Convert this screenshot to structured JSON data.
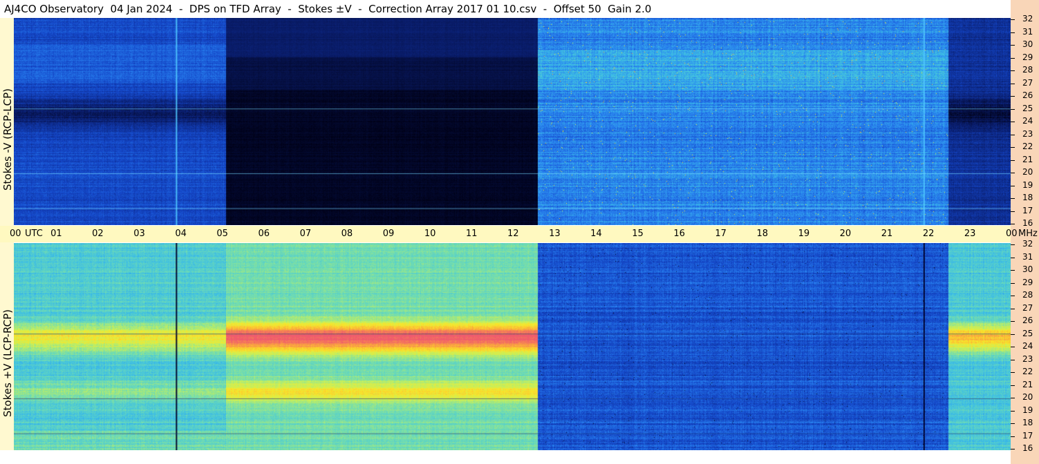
{
  "title": "AJ4CO Observatory  04 Jan 2024  -  DPS on TFD Array  -  Stokes ±V  -  Correction Array 2017 01 10.csv  -  Offset 50  Gain 2.0",
  "chart_data": [
    {
      "type": "heatmap",
      "title": "",
      "ylabel": "Stokes -V (RCP-LCP)",
      "xlabel": "UTC",
      "y_unit": "MHz",
      "ylim": [
        16,
        32
      ],
      "xlim": [
        0,
        24
      ],
      "y_ticks": [
        16,
        17,
        18,
        19,
        20,
        21,
        22,
        23,
        24,
        25,
        26,
        27,
        28,
        29,
        30,
        31,
        32
      ],
      "x_tick_labels": [
        "00",
        "01",
        "02",
        "03",
        "04",
        "05",
        "06",
        "07",
        "08",
        "09",
        "10",
        "11",
        "12",
        "13",
        "14",
        "15",
        "16",
        "17",
        "18",
        "19",
        "20",
        "21",
        "22",
        "23",
        "00"
      ],
      "segments": [
        {
          "x0": 0,
          "x1": 5.1,
          "level": "medium-blue"
        },
        {
          "x0": 5.1,
          "x1": 12.6,
          "level": "near-black"
        },
        {
          "x0": 12.6,
          "x1": 22.5,
          "level": "bright-blue"
        },
        {
          "x0": 22.5,
          "x1": 24,
          "level": "dark-blue"
        }
      ]
    },
    {
      "type": "heatmap",
      "title": "",
      "ylabel": "Stokes +V (LCP-RCP)",
      "xlabel": "UTC",
      "y_unit": "MHz",
      "ylim": [
        16,
        32
      ],
      "xlim": [
        0,
        24
      ],
      "y_ticks": [
        16,
        17,
        18,
        19,
        20,
        21,
        22,
        23,
        24,
        25,
        26,
        27,
        28,
        29,
        30,
        31,
        32
      ],
      "segments": [
        {
          "x0": 0,
          "x1": 5.1,
          "level": "cyan-yellow"
        },
        {
          "x0": 5.1,
          "x1": 12.6,
          "level": "yellow-red"
        },
        {
          "x0": 12.6,
          "x1": 22.5,
          "level": "blue"
        },
        {
          "x0": 22.5,
          "x1": 24,
          "level": "cyan-yellow"
        }
      ]
    }
  ],
  "axis": {
    "utc_label": "UTC",
    "mhz_label": "MHz"
  },
  "colors": {
    "time_axis_bg": "#fff9c0",
    "freq_axis_bg": "#f9d6b8"
  }
}
